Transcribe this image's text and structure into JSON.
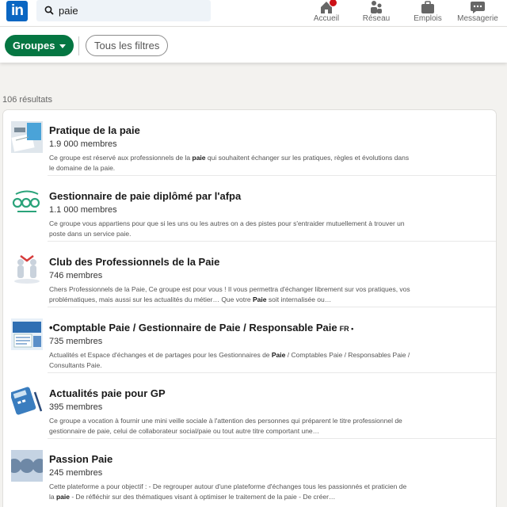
{
  "nav": {
    "search_query": "paie",
    "items": [
      {
        "label": "Accueil",
        "icon": "home-icon"
      },
      {
        "label": "Réseau",
        "icon": "network-icon"
      },
      {
        "label": "Emplois",
        "icon": "briefcase-icon"
      },
      {
        "label": "Messagerie",
        "icon": "messaging-icon"
      }
    ]
  },
  "filters": {
    "groups_label": "Groupes",
    "all_filters_label": "Tous les filtres"
  },
  "results_count": "106 résultats",
  "results": [
    {
      "title": "Pratique de la paie",
      "members": "1.9 000 membres",
      "desc": [
        "Ce groupe est réservé aux professionnels de la ",
        "paie",
        " qui souhaitent échanger sur les pratiques, règles et évolutions dans le domaine de la paie."
      ]
    },
    {
      "title": "Gestionnaire de paie diplômé par l'afpa",
      "members": "1.1 000 membres",
      "desc": [
        "Ce groupe vous appartiens pour que si les uns ou les autres on a des pistes pour s'entraider mutuellement à trouver un poste dans un service paie.",
        "",
        ""
      ]
    },
    {
      "title": "Club des Professionnels de la Paie",
      "members": "746 membres",
      "desc": [
        "Chers Professionnels de la Paie, Ce groupe est pour vous ! Il vous permettra d'échanger librement sur vos pratiques, vos problématiques, mais aussi sur les actualités du métier… Que votre ",
        "Paie",
        " soit internalisée ou…"
      ]
    },
    {
      "title": "•Comptable Paie / Gestionnaire de Paie / Responsable Paie",
      "title_suffix": "FR •",
      "members": "735 membres",
      "desc": [
        "Actualités et Espace d'échanges et de partages pour les Gestionnaires de ",
        "Paie",
        " / Comptables Paie / Responsables Paie / Consultants Paie."
      ]
    },
    {
      "title": "Actualités paie pour GP",
      "members": "395 membres",
      "desc": [
        "Ce groupe a vocation à fournir une mini veille sociale à l'attention des personnes qui préparent le titre professionnel de gestionnaire de paie, celui de collaborateur social/paie ou tout autre titre comportant une…",
        "",
        ""
      ]
    },
    {
      "title": "Passion Paie",
      "members": "245 membres",
      "desc": [
        "Cette plateforme a pour objectif : - De regrouper autour d'une plateforme d'échanges tous les passionnés et praticien de la ",
        "paie",
        " - De réfléchir sur des thématiques visant à optimiser le traitement de la paie - De créer…"
      ]
    }
  ],
  "colors": {
    "brand_blue": "#0a66c2",
    "groups_green": "#057642",
    "notif_red": "#cc1016"
  }
}
